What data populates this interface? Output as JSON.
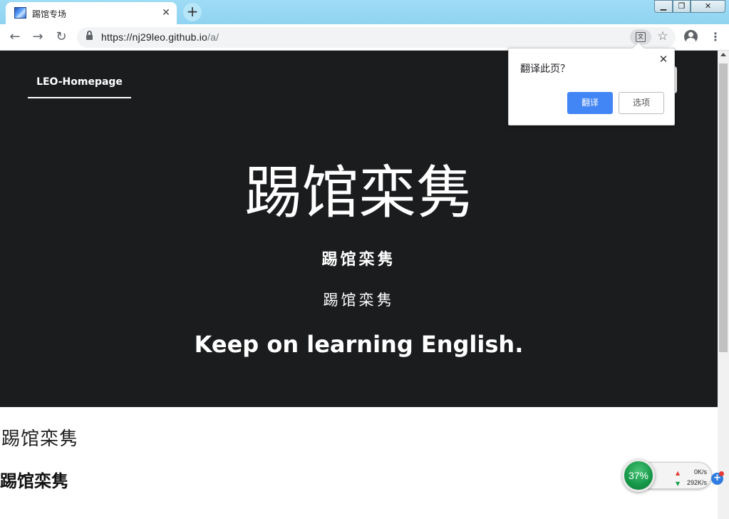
{
  "browser": {
    "tab": {
      "title": "踢馆专场",
      "close": "✕"
    },
    "new_tab": "+",
    "window_controls": {
      "minimize": "▁",
      "maximize": "❐",
      "close": "✕"
    },
    "nav": {
      "back": "←",
      "forward": "→",
      "reload": "↻"
    },
    "url": {
      "host": "https://nj29leo.github.io",
      "path": "/a/"
    },
    "star": "☆",
    "menu": "⋮"
  },
  "translate_popup": {
    "title": "翻译此页？",
    "close": "✕",
    "translate_label": "翻译",
    "options_label": "选项"
  },
  "page": {
    "nav_home": "LEO-Homepage",
    "hero_title": "踢馆栾隽",
    "hero_sub1": "踢馆栾隽",
    "hero_sub2": "踢馆栾隽",
    "hero_tagline": "Keep on learning English.",
    "line1": "踢馆栾隽",
    "line2": "踢馆栾隽"
  },
  "net_widget": {
    "percent": "37%",
    "upload": "0K/s",
    "download": "292K/s",
    "plus": "+"
  },
  "colors": {
    "hero_bg": "#1b1c1e",
    "translate_button": "#4285f4",
    "green_text": "#1f7a1f",
    "titlebar": "#8fd3f1"
  }
}
